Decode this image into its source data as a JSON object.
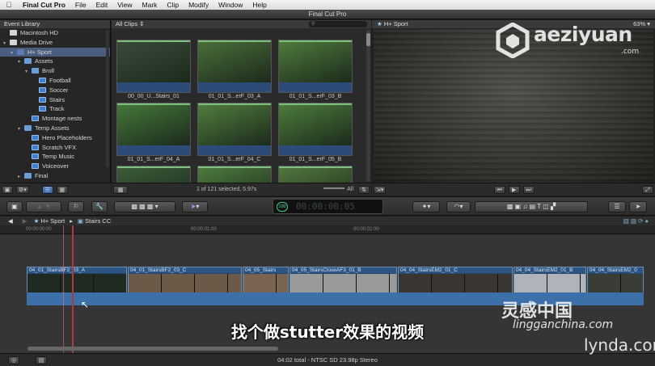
{
  "menubar": {
    "items": [
      {
        "label": "Final Cut Pro",
        "bold": true
      },
      {
        "label": "File"
      },
      {
        "label": "Edit"
      },
      {
        "label": "View"
      },
      {
        "label": "Mark"
      },
      {
        "label": "Clip"
      },
      {
        "label": "Modify"
      },
      {
        "label": "Window"
      },
      {
        "label": "Help"
      }
    ]
  },
  "window": {
    "title": "Final Cut Pro"
  },
  "library": {
    "header": "Event Library",
    "items": [
      {
        "label": "Macintosh HD",
        "depth": 0,
        "icon": "disk",
        "expanded": null
      },
      {
        "label": "Media Drive",
        "depth": 0,
        "icon": "disk",
        "expanded": true
      },
      {
        "label": "H+ Sport",
        "depth": 1,
        "icon": "star",
        "expanded": true,
        "selected": true
      },
      {
        "label": "Assets",
        "depth": 2,
        "icon": "folder",
        "expanded": true
      },
      {
        "label": "Broll",
        "depth": 3,
        "icon": "folder",
        "expanded": true
      },
      {
        "label": "Football",
        "depth": 4,
        "icon": "event"
      },
      {
        "label": "Soccer",
        "depth": 4,
        "icon": "event"
      },
      {
        "label": "Stairs",
        "depth": 4,
        "icon": "event"
      },
      {
        "label": "Track",
        "depth": 4,
        "icon": "event"
      },
      {
        "label": "Montage nests",
        "depth": 3,
        "icon": "event"
      },
      {
        "label": "Temp Assets",
        "depth": 2,
        "icon": "folder",
        "expanded": true
      },
      {
        "label": "Hero Placeholders",
        "depth": 3,
        "icon": "event"
      },
      {
        "label": "Scratch VFX",
        "depth": 3,
        "icon": "event"
      },
      {
        "label": "Temp Music",
        "depth": 3,
        "icon": "event"
      },
      {
        "label": "Voiceover",
        "depth": 3,
        "icon": "event"
      },
      {
        "label": "Final",
        "depth": 2,
        "icon": "folder",
        "expanded": false
      }
    ]
  },
  "browser": {
    "filter": "All Clips",
    "search_placeholder": "",
    "clips": [
      {
        "name": "00_00_U...Stairs_01",
        "col": 0,
        "row": 0,
        "tone": "#3a4a3a"
      },
      {
        "name": "01_01_S...erF_03_A",
        "col": 1,
        "row": 0,
        "tone": "#4a6e3a"
      },
      {
        "name": "01_01_S...erF_03_B",
        "col": 2,
        "row": 0,
        "tone": "#4f7a3c"
      },
      {
        "name": "01_01_S...erF_04_A",
        "col": 0,
        "row": 1,
        "tone": "#45763a"
      },
      {
        "name": "01_01_S...erF_04_C",
        "col": 1,
        "row": 1,
        "tone": "#517c3e"
      },
      {
        "name": "01_01_S...erF_05_B",
        "col": 2,
        "row": 1,
        "tone": "#4d7b3c"
      },
      {
        "name": "",
        "col": 0,
        "row": 2,
        "tone": "#3c5b3a"
      },
      {
        "name": "",
        "col": 1,
        "row": 2,
        "tone": "#4e7a3e"
      },
      {
        "name": "",
        "col": 2,
        "row": 2,
        "tone": "#52773e"
      }
    ],
    "status": "1 of 121 selected, 5.97s",
    "all_label": "All"
  },
  "viewer": {
    "title": "H+ Sport",
    "zoom": "63%"
  },
  "timecode": {
    "value": "00:00:00:05",
    "percent": "100"
  },
  "timeline": {
    "breadcrumb_project": "H+ Sport",
    "breadcrumb_clip": "Stairs CC",
    "ruler": [
      "00:00:00:00",
      "00:00:01:00",
      "00:00:02:00"
    ],
    "clips": [
      {
        "name": "04_01_StairsBF2_03_A",
        "tone": "#1e2a22"
      },
      {
        "name": "04_01_StairsBF2_03_C",
        "tone": "#6b5a48"
      },
      {
        "name": "04_05_Stairs",
        "tone": "#7a6552"
      },
      {
        "name": "04_05_StairsCloseAF3_01_B",
        "tone": "#9a9a98"
      },
      {
        "name": "04_04_StairsEM2_01_C",
        "tone": "#3a3530"
      },
      {
        "name": "04_04_StairsEM2_01_B",
        "tone": "#b0b4ba"
      },
      {
        "name": "04_04_StairsEM2_0",
        "tone": "#3a3d36"
      }
    ]
  },
  "status_bar": {
    "text": "04:02 total - NTSC SD 23.98p Stereo"
  },
  "subtitle": "找个做stutter效果的视频",
  "watermarks": {
    "aeziyuan": "aeziyuan",
    "aeziyuan_com": ".com",
    "lingan_cn": "灵感中国",
    "lingan_en": "lingganchina.com",
    "lynda": "lynda.com"
  },
  "colors": {
    "selection": "#4a5d7e",
    "clip_border": "#6c8fb8",
    "playhead": "#b23a3a",
    "accent_blue": "#3562a5"
  }
}
